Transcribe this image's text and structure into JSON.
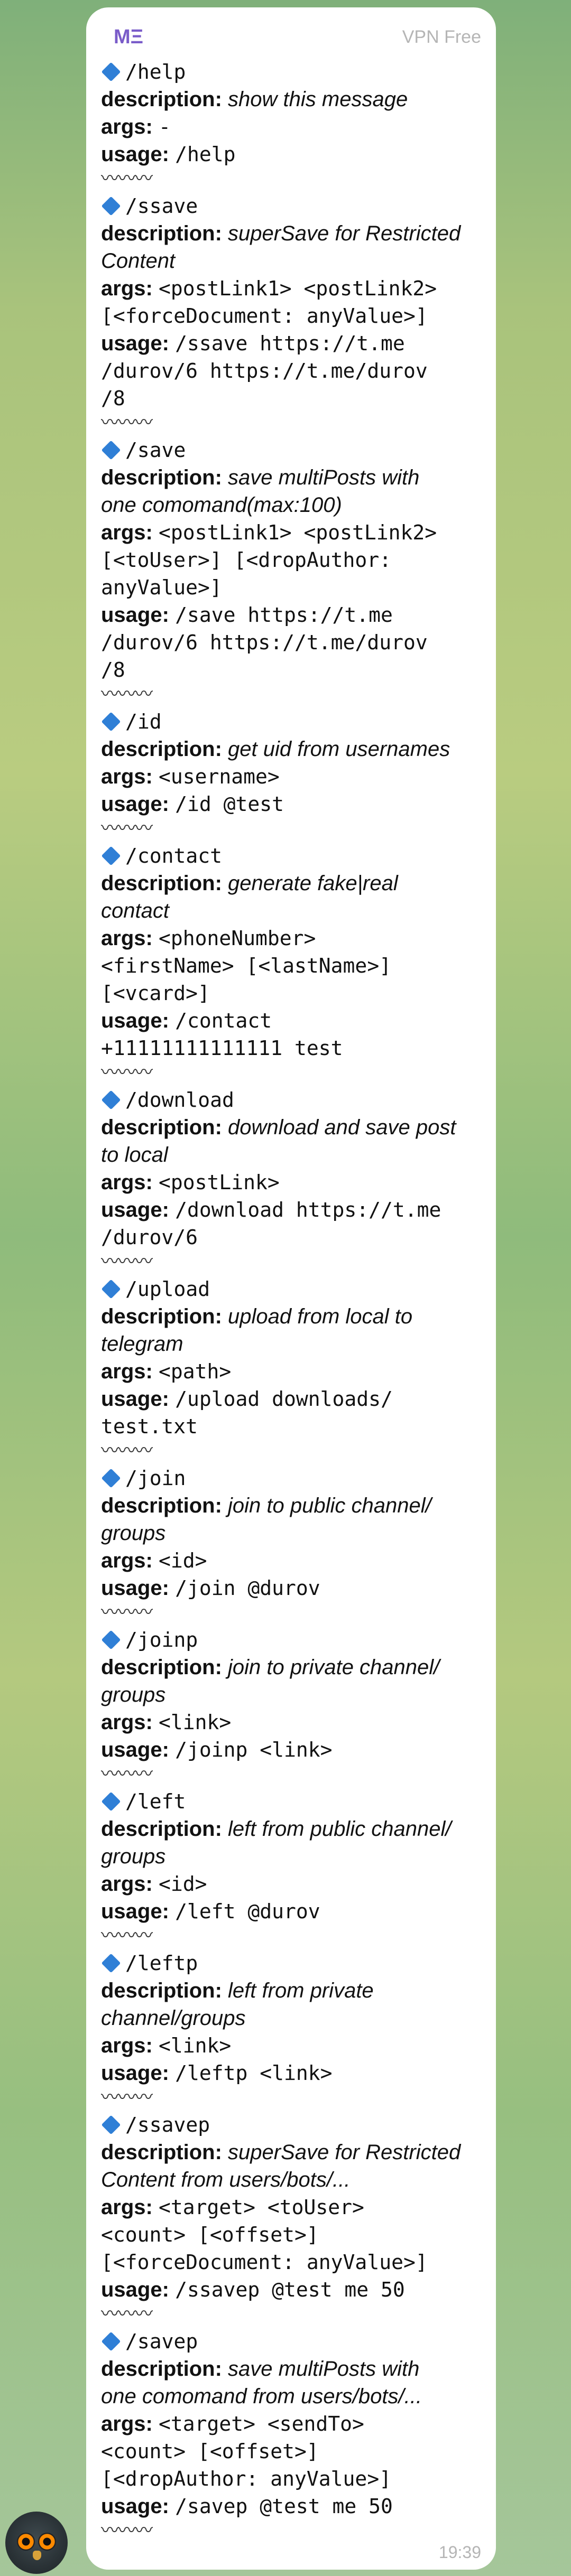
{
  "header": {
    "sender": "MΞ",
    "badge": "VPN Free"
  },
  "footer": {
    "time": "19:39"
  },
  "labels": {
    "description": "description:",
    "args": "args:",
    "usage": "usage:",
    "separator": "〰〰〰"
  },
  "commands": [
    {
      "name": "/help",
      "description": "show this message",
      "args": [
        "-"
      ],
      "usage": [
        "/help"
      ]
    },
    {
      "name": "/ssave",
      "description": "superSave for Restricted\nContent",
      "args": [
        "<postLink1> <postLink2>",
        "[<forceDocument: anyValue>]"
      ],
      "usage": [
        "/ssave https://t.me",
        "/durov/6 https://t.me/durov",
        "/8"
      ]
    },
    {
      "name": "/save",
      "description": "save multiPosts with\none comomand(max:100)",
      "args": [
        "<postLink1> <postLink2>",
        "[<toUser>] [<dropAuthor:",
        "anyValue>]"
      ],
      "usage": [
        "/save https://t.me",
        "/durov/6 https://t.me/durov",
        "/8"
      ]
    },
    {
      "name": "/id",
      "description": "get uid from usernames",
      "args": [
        "<username>"
      ],
      "usage": [
        "/id @test"
      ]
    },
    {
      "name": "/contact",
      "description": "generate fake|real\ncontact",
      "args": [
        "<phoneNumber>",
        "<firstName> [<lastName>]",
        "[<vcard>]"
      ],
      "usage": [
        "/contact",
        "+11111111111111 test"
      ]
    },
    {
      "name": "/download",
      "description": "download and save post\nto local",
      "args": [
        "<postLink>"
      ],
      "usage": [
        "/download https://t.me",
        "/durov/6"
      ]
    },
    {
      "name": "/upload",
      "description": "upload from local to\ntelegram",
      "args": [
        "<path>"
      ],
      "usage": [
        "/upload downloads/",
        "test.txt"
      ]
    },
    {
      "name": "/join",
      "description": "join to public channel/\ngroups",
      "args": [
        "<id>"
      ],
      "usage": [
        "/join @durov"
      ]
    },
    {
      "name": "/joinp",
      "description": "join to private channel/\ngroups",
      "args": [
        "<link>"
      ],
      "usage": [
        "/joinp <link>"
      ]
    },
    {
      "name": "/left",
      "description": "left from public channel/\ngroups",
      "args": [
        "<id>"
      ],
      "usage": [
        "/left @durov"
      ]
    },
    {
      "name": "/leftp",
      "description": "left from private\nchannel/groups",
      "args": [
        "<link>"
      ],
      "usage": [
        "/leftp <link>"
      ]
    },
    {
      "name": "/ssavep",
      "description": "superSave for Restricted\nContent from users/bots/...",
      "args": [
        "<target> <toUser>",
        "<count> [<offset>]",
        "[<forceDocument: anyValue>]"
      ],
      "usage": [
        "/ssavep @test me 50"
      ]
    },
    {
      "name": "/savep",
      "description": "save multiPosts with\none comomand from users/bots/...",
      "args": [
        "<target> <sendTo>",
        "<count> [<offset>]",
        "[<dropAuthor: anyValue>]"
      ],
      "usage": [
        "/savep @test me 50"
      ]
    }
  ]
}
